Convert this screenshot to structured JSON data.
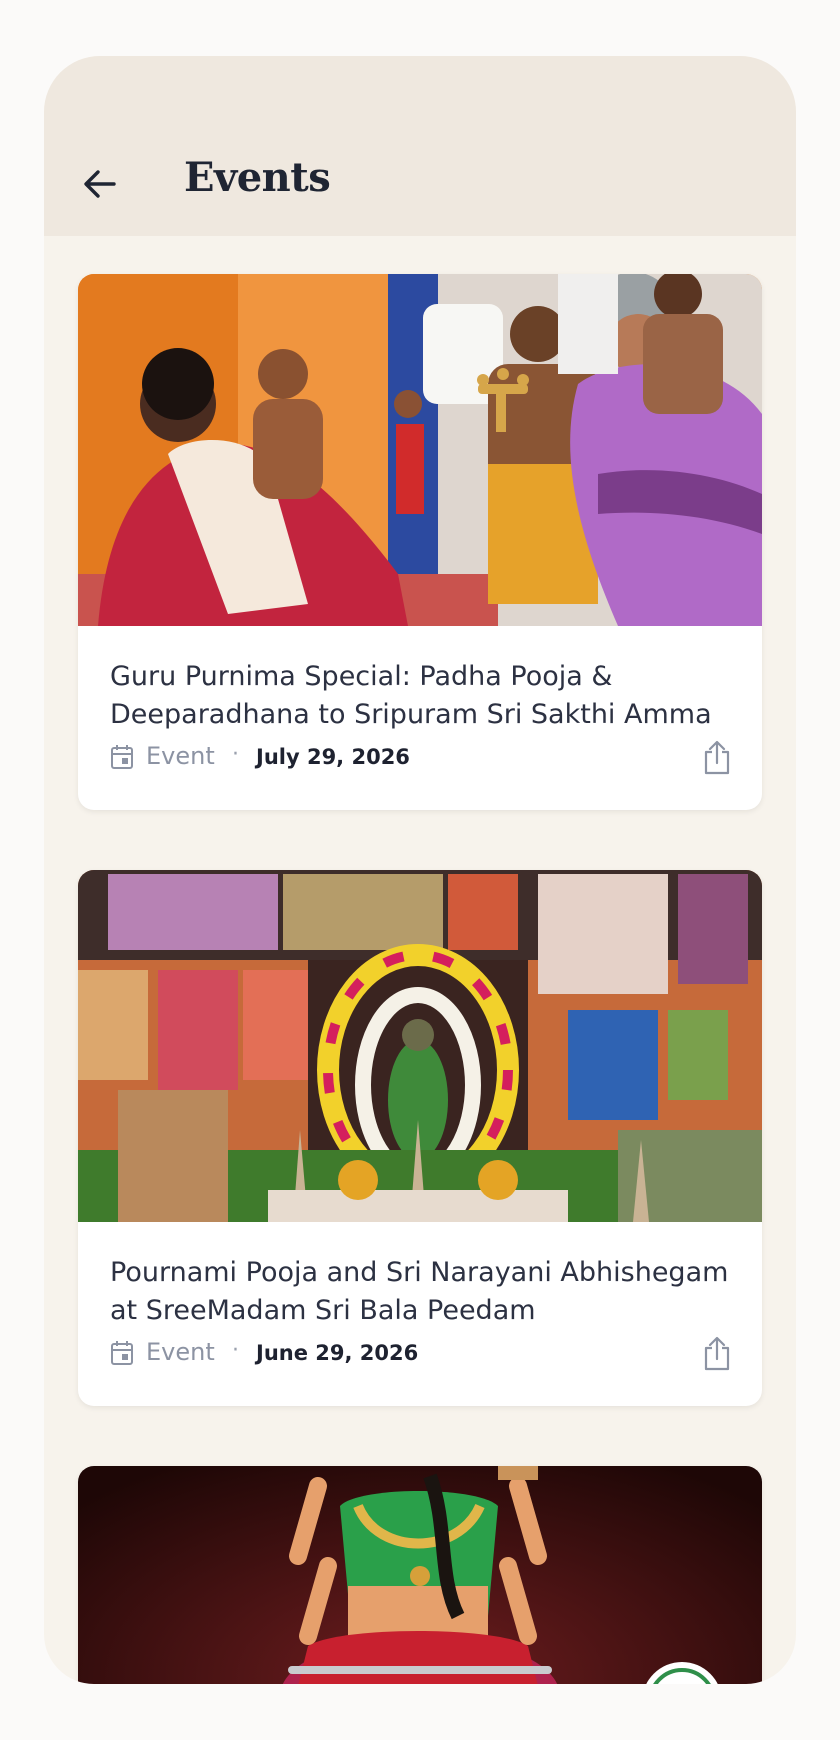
{
  "header": {
    "title": "Events",
    "back_icon": "arrow-left-icon"
  },
  "events": [
    {
      "title": "Guru Purnima Special: Padha Pooja & Deeparadhana to Sripuram Sri Sakthi Amma",
      "type": "Event",
      "date": "July 29, 2026",
      "image_subject": "devotees performing aarti with a brass lamp to a garlanded guru in a saffron-walled room"
    },
    {
      "title": "Pournami Pooja and Sri Narayani Abhishegam at SreeMadam Sri Bala Peedam",
      "type": "Event",
      "date": "June 29, 2026",
      "image_subject": "altar decorated with flower garlands, brass lamps and framed deity pictures"
    },
    {
      "image_subject": "illustration of a seated goddess in red and green with lotus and temple seal"
    }
  ],
  "meta": {
    "separator": "·",
    "calendar_icon": "calendar-icon",
    "share_icon": "share-icon"
  },
  "colors": {
    "background": "#f7f3ec",
    "appbar": "#efe8df",
    "title": "#1f2533",
    "muted": "#8c93a3"
  }
}
